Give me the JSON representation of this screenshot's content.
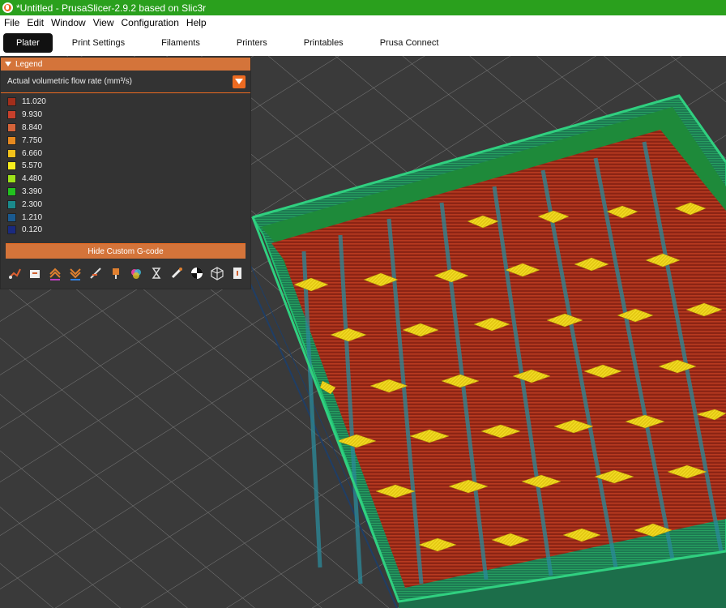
{
  "window": {
    "title": "*Untitled - PrusaSlicer-2.9.2 based on Slic3r"
  },
  "menu": [
    "File",
    "Edit",
    "Window",
    "View",
    "Configuration",
    "Help"
  ],
  "tabs": [
    {
      "label": "Plater",
      "active": true
    },
    {
      "label": "Print Settings"
    },
    {
      "label": "Filaments"
    },
    {
      "label": "Printers"
    },
    {
      "label": "Printables"
    },
    {
      "label": "Prusa Connect"
    }
  ],
  "legend": {
    "title": "Legend",
    "view_type": "Actual volumetric flow rate (mm³/s)",
    "scale": [
      {
        "value": "11.020",
        "color": "#a32e1b"
      },
      {
        "value": "9.930",
        "color": "#c8402c"
      },
      {
        "value": "8.840",
        "color": "#d5643a"
      },
      {
        "value": "7.750",
        "color": "#e68a1f"
      },
      {
        "value": "6.660",
        "color": "#f3c21a"
      },
      {
        "value": "5.570",
        "color": "#f7ee1d"
      },
      {
        "value": "4.480",
        "color": "#9ee21a"
      },
      {
        "value": "3.390",
        "color": "#22c21f"
      },
      {
        "value": "2.300",
        "color": "#1a8a8c"
      },
      {
        "value": "1.210",
        "color": "#1a5a90"
      },
      {
        "value": "0.120",
        "color": "#1a2a80"
      }
    ],
    "hide_button": "Hide Custom G-code",
    "toolbar_icons": [
      "travel-icon",
      "wipe-icon",
      "retractions-icon",
      "deretractions-icon",
      "seams-icon",
      "tool-changes-icon",
      "color-changes-icon",
      "pause-prints-icon",
      "custom-gcode-icon",
      "center-of-gravity-icon",
      "shells-icon",
      "tool-marker-icon"
    ]
  },
  "accent": "#ed6b21"
}
